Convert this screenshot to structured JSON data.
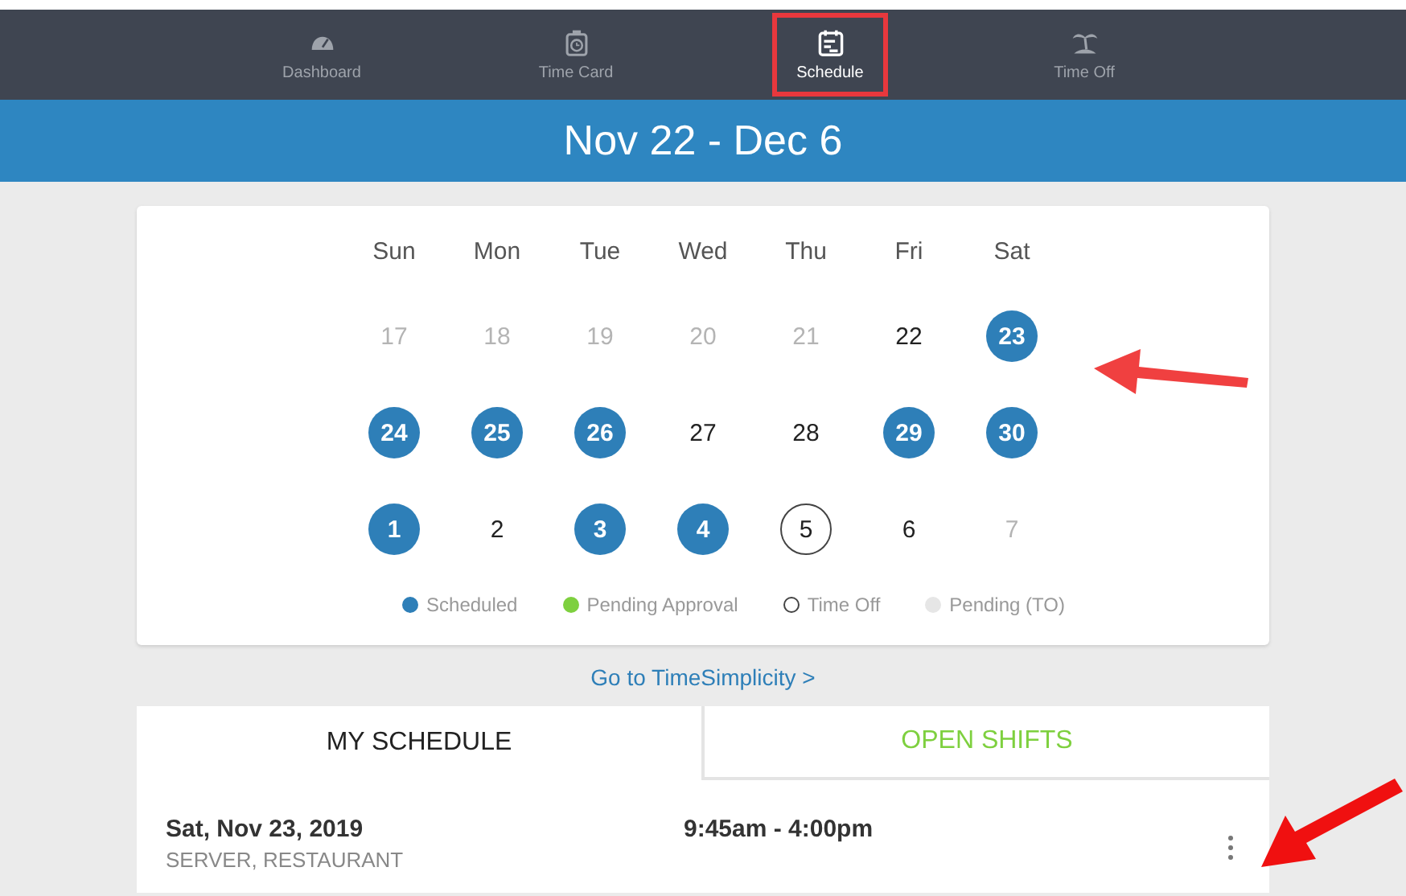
{
  "nav": [
    {
      "label": "Dashboard",
      "selected": false,
      "highlighted": false
    },
    {
      "label": "Time Card",
      "selected": false,
      "highlighted": false
    },
    {
      "label": "Schedule",
      "selected": true,
      "highlighted": true
    },
    {
      "label": "Time Off",
      "selected": false,
      "highlighted": false
    }
  ],
  "header": {
    "title": "Nov 22 - Dec 6"
  },
  "calendar": {
    "weekdays": [
      "Sun",
      "Mon",
      "Tue",
      "Wed",
      "Thu",
      "Fri",
      "Sat"
    ],
    "weeks": [
      [
        {
          "day": "17",
          "kind": "outside"
        },
        {
          "day": "18",
          "kind": "outside"
        },
        {
          "day": "19",
          "kind": "outside"
        },
        {
          "day": "20",
          "kind": "outside"
        },
        {
          "day": "21",
          "kind": "outside"
        },
        {
          "day": "22",
          "kind": "plain"
        },
        {
          "day": "23",
          "kind": "scheduled"
        }
      ],
      [
        {
          "day": "24",
          "kind": "scheduled"
        },
        {
          "day": "25",
          "kind": "scheduled"
        },
        {
          "day": "26",
          "kind": "scheduled"
        },
        {
          "day": "27",
          "kind": "plain"
        },
        {
          "day": "28",
          "kind": "plain"
        },
        {
          "day": "29",
          "kind": "scheduled"
        },
        {
          "day": "30",
          "kind": "scheduled"
        }
      ],
      [
        {
          "day": "1",
          "kind": "scheduled"
        },
        {
          "day": "2",
          "kind": "plain"
        },
        {
          "day": "3",
          "kind": "scheduled"
        },
        {
          "day": "4",
          "kind": "scheduled"
        },
        {
          "day": "5",
          "kind": "timeoff"
        },
        {
          "day": "6",
          "kind": "plain"
        },
        {
          "day": "7",
          "kind": "outside"
        }
      ]
    ],
    "legend": [
      {
        "label": "Scheduled",
        "kind": "filled",
        "color": "#2e7fb8"
      },
      {
        "label": "Pending Approval",
        "kind": "filled",
        "color": "#7ed03f"
      },
      {
        "label": "Time Off",
        "kind": "ring",
        "color": "#444444"
      },
      {
        "label": "Pending (TO)",
        "kind": "filled",
        "color": "#e6e6e6"
      }
    ]
  },
  "link": "Go to TimeSimplicity >",
  "tabs": [
    {
      "label": "MY SCHEDULE",
      "selected": true
    },
    {
      "label": "OPEN SHIFTS",
      "selected": false
    }
  ],
  "shifts": [
    {
      "date": "Sat, Nov 23, 2019",
      "role": "SERVER, RESTAURANT",
      "time": "9:45am - 4:00pm"
    }
  ]
}
